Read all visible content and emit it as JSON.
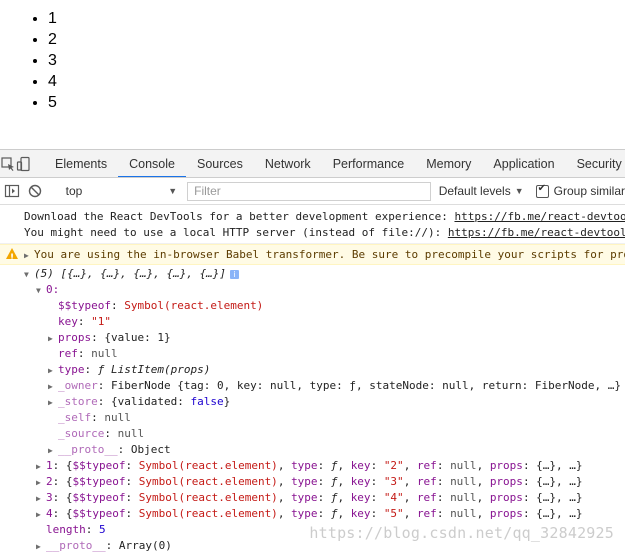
{
  "page": {
    "list_items": [
      "1",
      "2",
      "3",
      "4",
      "5"
    ]
  },
  "devtools": {
    "tabs": [
      "Elements",
      "Console",
      "Sources",
      "Network",
      "Performance",
      "Memory",
      "Application",
      "Security"
    ],
    "active_tab": "Console",
    "accent_color": "#1a73e8",
    "toolbar": {
      "context": "top",
      "filter_placeholder": "Filter",
      "levels_label": "Default levels",
      "group_label": "Group similar"
    }
  },
  "console": {
    "messages": [
      {
        "line1_text": "Download the React DevTools for a better development experience: ",
        "line1_link": "https://fb.me/react-devtools",
        "line2_text": "You might need to use a local HTTP server (instead of file://): ",
        "line2_link": "https://fb.me/react-devtools-faq"
      }
    ],
    "warning": "You are using the in-browser Babel transformer. Be sure to precompile your scripts for production",
    "array_summary": "(5) [{…}, {…}, {…}, {…}, {…}]",
    "item0": {
      "index": "0:",
      "typeof_key": "$$typeof",
      "typeof_val": "Symbol(react.element)",
      "key_key": "key",
      "key_val": "\"1\"",
      "props_key": "props",
      "props_val": "{value: 1}",
      "ref_key": "ref",
      "ref_val": "null",
      "type_key": "type",
      "type_val": "ƒ ListItem(props)",
      "owner_key": "_owner",
      "owner_val": "FiberNode {tag: 0, key: null, type: ƒ, stateNode: null, return: FiberNode, …}",
      "store_key": "_store",
      "store_val_pre": "{validated: ",
      "store_val_bool": "false",
      "store_val_post": "}",
      "self_key": "_self",
      "self_val": "null",
      "source_key": "_source",
      "source_val": "null",
      "proto_key": "__proto__",
      "proto_val": "Object"
    },
    "other_items": [
      {
        "index": "1",
        "key": "\"2\""
      },
      {
        "index": "2",
        "key": "\"3\""
      },
      {
        "index": "3",
        "key": "\"4\""
      },
      {
        "index": "4",
        "key": "\"5\""
      }
    ],
    "length_key": "length",
    "length_val": "5",
    "array_proto_key": "__proto__",
    "array_proto_val": "Array(0)"
  },
  "watermark": "https://blog.csdn.net/qq_32842925"
}
